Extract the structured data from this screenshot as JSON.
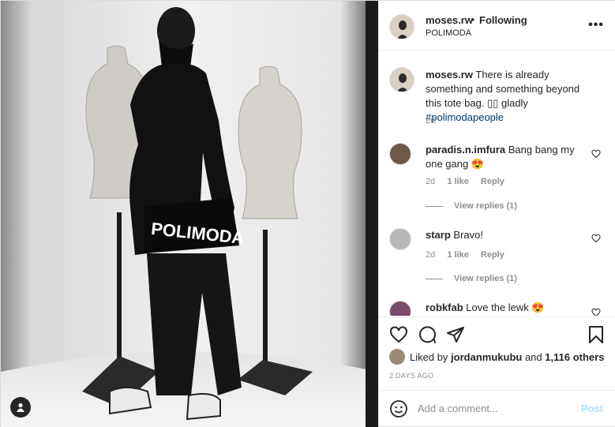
{
  "photo": {
    "bag_text": "POLIMODA"
  },
  "header": {
    "username": "moses.rw",
    "separator": "•",
    "follow_label": "Following",
    "location": "POLIMODA",
    "more": "•••"
  },
  "caption": {
    "username": "moses.rw",
    "text": "There is already something and something beyond this tote bag. ▯▯ gladly",
    "hashtag": "#polimodapeople",
    "time": "2d"
  },
  "comments": [
    {
      "username": "paradis.n.imfura",
      "text": "Bang bang my one gang 😍",
      "time": "2d",
      "likes": "1 like",
      "reply": "Reply",
      "view_replies": "View replies (1)"
    },
    {
      "username": "starp",
      "text": "Bravo!",
      "time": "2d",
      "likes": "1 like",
      "reply": "Reply",
      "view_replies": "View replies (1)"
    },
    {
      "username": "robkfab",
      "text": "Love the lewk 😍"
    }
  ],
  "likes": {
    "prefix": "Liked by",
    "user": "jordanmukubu",
    "middle": "and",
    "others": "1,116 others"
  },
  "date": "2 DAYS AGO",
  "add_comment": {
    "placeholder": "Add a comment...",
    "post_label": "Post"
  },
  "icons": {
    "heart": "heart-icon",
    "comment": "comment-icon",
    "share": "share-icon",
    "save": "bookmark-icon",
    "emoji": "emoji-icon",
    "tag": "user-tag-icon"
  }
}
